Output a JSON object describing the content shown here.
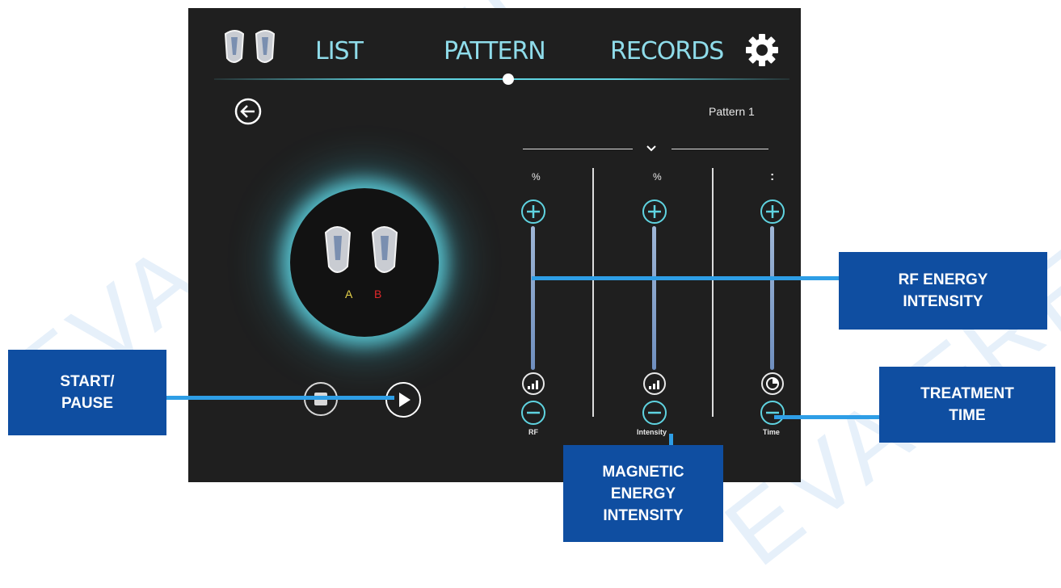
{
  "watermark": {
    "text": "EVA FRESHLY"
  },
  "header": {
    "tabs": [
      {
        "label": "LIST"
      },
      {
        "label": "PATTERN"
      },
      {
        "label": "RECORDS"
      }
    ],
    "settings_icon": "gear-icon",
    "logo_icon": "handpiece-pair-icon"
  },
  "pattern": {
    "name": "Pattern 1"
  },
  "handpieces": {
    "a_label": "A",
    "b_label": "B",
    "a_color": "#e6d24a",
    "b_color": "#e0282a"
  },
  "controls": [
    {
      "unit": "%",
      "label": "RF",
      "level_icon": "signal-level-icon"
    },
    {
      "unit": "%",
      "label": "Intensity",
      "level_icon": "signal-level-icon"
    },
    {
      "unit": ":",
      "label": "Time",
      "level_icon": "timer-icon"
    }
  ],
  "callouts": {
    "start_pause": [
      "START/",
      "PAUSE"
    ],
    "rf_energy": [
      "RF ENERGY",
      "INTENSITY"
    ],
    "treatment_time": [
      "TREATMENT",
      "TIME"
    ],
    "magnetic_energy": [
      "MAGNETIC",
      "ENERGY",
      "INTENSITY"
    ]
  },
  "colors": {
    "accent": "#5fd3e0",
    "callout": "#0f4ea1",
    "pointer_line": "#2e9ee6",
    "screen_bg": "#1f1f1f"
  }
}
